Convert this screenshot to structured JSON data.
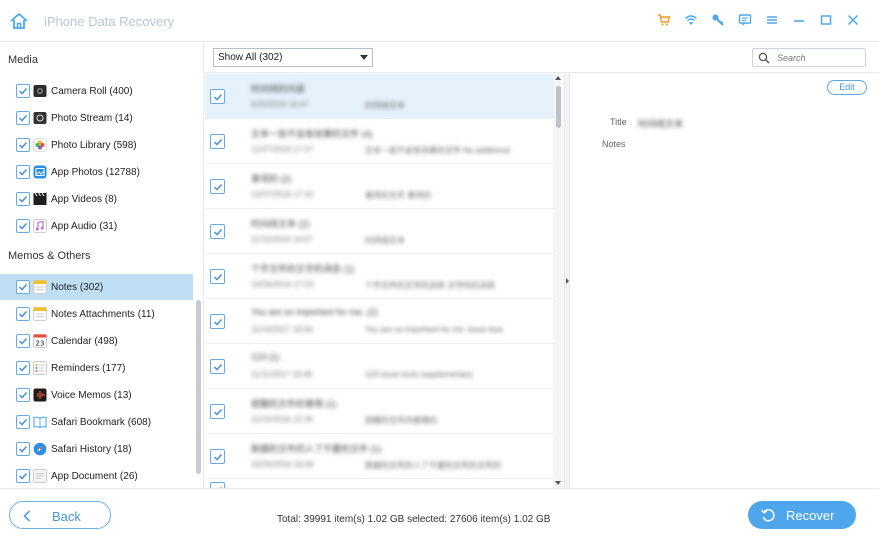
{
  "app": {
    "title": "iPhone Data Recovery"
  },
  "colors": {
    "accent": "#4ea6ec",
    "selection": "#bfe0f4",
    "checkbox": "#4a90d9"
  },
  "sidebar": {
    "groups": [
      {
        "label": "Media",
        "items": [
          {
            "label": "Camera Roll (400)",
            "icon": "camera-icon"
          },
          {
            "label": "Photo Stream (14)",
            "icon": "photo-stream-icon"
          },
          {
            "label": "Photo Library (598)",
            "icon": "photos-icon"
          },
          {
            "label": "App Photos (12788)",
            "icon": "app-photos-icon"
          },
          {
            "label": "App Videos (8)",
            "icon": "clapper-icon"
          },
          {
            "label": "App Audio (31)",
            "icon": "music-note-icon"
          }
        ]
      },
      {
        "label": "Memos & Others",
        "items": [
          {
            "label": "Notes (302)",
            "icon": "notes-icon",
            "selected": true
          },
          {
            "label": "Notes Attachments (11)",
            "icon": "notes-attachment-icon"
          },
          {
            "label": "Calendar (498)",
            "icon": "calendar-icon",
            "badge": "23"
          },
          {
            "label": "Reminders (177)",
            "icon": "reminders-icon"
          },
          {
            "label": "Voice Memos (13)",
            "icon": "voice-memos-icon"
          },
          {
            "label": "Safari Bookmark (608)",
            "icon": "bookmark-icon"
          },
          {
            "label": "Safari History (18)",
            "icon": "safari-icon"
          },
          {
            "label": "App Document (26)",
            "icon": "document-icon"
          }
        ]
      }
    ]
  },
  "toolbar": {
    "filter_value": "Show All (302)",
    "search_placeholder": "Search"
  },
  "list": {
    "rows": [
      {
        "title": "时间线的内容",
        "date": "9/20/2016 16:47",
        "preview": "时间线文本",
        "selected": true
      },
      {
        "title": "文本一些不会有效果的文件 (4)",
        "date": "12/27/2016 17:27",
        "preview": "文本一些不会有效果的文件 No additional",
        "selected": false
      },
      {
        "title": "事项的 (2)",
        "date": "12/27/2016 17:10",
        "preview": "事项的文件 事项的",
        "selected": false
      },
      {
        "title": "时间线文本 (2)",
        "date": "11/15/2016 14:07",
        "preview": "时间线文本",
        "selected": false
      },
      {
        "title": "个字文件的文字的消息 (1)",
        "date": "10/26/2016 17:23",
        "preview": "个字文件的文字的消息 文字的的消息",
        "selected": false
      },
      {
        "title": "You are so important for me. (2)",
        "date": "11/13/2017 19:56",
        "preview": "You are so important for me. issue less",
        "selected": false
      },
      {
        "title": "123 (1)",
        "date": "11/11/2017 18:49",
        "preview": "123 issue tools supplementary",
        "selected": false
      },
      {
        "title": "提醒的文件的事情 (1)",
        "date": "11/15/2016 12:36",
        "preview": "提醒的文件的事情的",
        "selected": false
      },
      {
        "title": "数据的文件的人了不要的文件 (1)",
        "date": "10/26/2016 16:39",
        "preview": "数据的文件的人了不要的文件的文件的",
        "selected": false
      },
      {
        "title": "…",
        "date": "…",
        "preview": "…",
        "selected": false
      }
    ]
  },
  "detail": {
    "edit_label": "Edit",
    "title_label": "Title",
    "title_value": "时间线文本",
    "notes_label": "Notes"
  },
  "footer": {
    "back_label": "Back",
    "totals": "Total: 39991 item(s) 1.02 GB   selected: 27606 item(s) 1.02 GB",
    "recover_label": "Recover"
  }
}
